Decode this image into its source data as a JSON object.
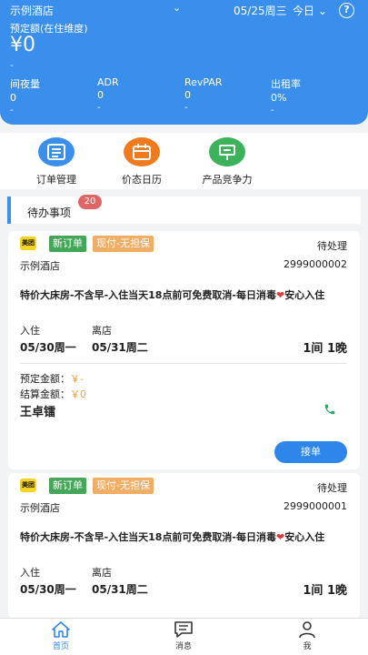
{
  "header": {
    "hotel_name": "示例酒店",
    "date": "05/25周三",
    "today_label": "今日",
    "help_label": "?",
    "amount_label": "预定额(在住维度)",
    "amount_value": "¥0",
    "amount_sub": "-",
    "stats": [
      {
        "label": "间夜量",
        "value": "0",
        "sub": "-"
      },
      {
        "label": "ADR",
        "value": "0",
        "sub": "-"
      },
      {
        "label": "RevPAR",
        "value": "0",
        "sub": "-"
      },
      {
        "label": "出租率",
        "value": "0%",
        "sub": "-"
      }
    ]
  },
  "menu": [
    {
      "label": "订单管理",
      "icon": "order-list-icon",
      "color": "#3a8fec"
    },
    {
      "label": "价态日历",
      "icon": "calendar-icon",
      "color": "#f07a1e"
    },
    {
      "label": "产品竞争力",
      "icon": "product-sign-icon",
      "color": "#3cb35a"
    }
  ],
  "todo": {
    "label": "待办事项",
    "count": "20"
  },
  "orders": [
    {
      "channel_logo": "美团",
      "tag_new": "新订单",
      "tag_pay": "现付-无担保",
      "status": "待处理",
      "hotel": "示例酒店",
      "order_no": "2999000002",
      "room_desc": "特价大床房-不含早-入住当天18点前可免费取消-每日消毒",
      "room_desc_tail": "安心入住",
      "checkin_label": "入住",
      "checkout_label": "离店",
      "checkin_date": "05/30周一",
      "checkout_date": "05/31周二",
      "rooms_nights": "1间  1晚",
      "booking_amount_label": "预定金额：",
      "booking_amount": "￥-",
      "settle_amount_label": "结算金额：",
      "settle_amount": "￥0",
      "guest": "王卓镭",
      "accept_label": "接单"
    },
    {
      "channel_logo": "美团",
      "tag_new": "新订单",
      "tag_pay": "现付-无担保",
      "status": "待处理",
      "hotel": "示例酒店",
      "order_no": "2999000001",
      "room_desc": "特价大床房-不含早-入住当天18点前可免费取消-每日消毒",
      "room_desc_tail": "安心入住",
      "checkin_label": "入住",
      "checkout_label": "离店",
      "checkin_date": "05/30周一",
      "checkout_date": "05/31周二",
      "rooms_nights": "1间  1晚"
    }
  ],
  "tabbar": [
    {
      "label": "首页",
      "icon": "home-icon"
    },
    {
      "label": "消息",
      "icon": "message-icon"
    },
    {
      "label": "我",
      "icon": "user-icon"
    }
  ],
  "colors": {
    "primary": "#3a8fec",
    "badge": "#e06666",
    "tag_new": "#45a65a",
    "tag_pay": "#f0ad66",
    "money": "#f0a040"
  }
}
